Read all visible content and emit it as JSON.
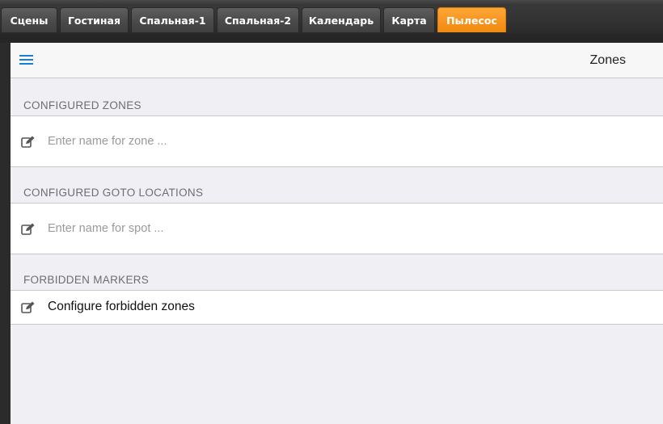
{
  "tabs": [
    {
      "label": "Сцены",
      "active": false
    },
    {
      "label": "Гостиная",
      "active": false
    },
    {
      "label": "Спальная-1",
      "active": false
    },
    {
      "label": "Спальная-2",
      "active": false
    },
    {
      "label": "Календарь",
      "active": false
    },
    {
      "label": "Карта",
      "active": false
    },
    {
      "label": "Пылесос",
      "active": true
    }
  ],
  "colors": {
    "active_tab": "#f7931e",
    "accent": "#1a7fd4"
  },
  "header": {
    "menu_icon": "hamburger-menu-icon",
    "title": "Zones"
  },
  "sections": {
    "zones": {
      "title": "CONFIGURED ZONES",
      "icon": "edit-icon",
      "placeholder": "Enter name for zone ..."
    },
    "goto": {
      "title": "CONFIGURED GOTO LOCATIONS",
      "icon": "edit-icon",
      "placeholder": "Enter name for spot ..."
    },
    "forbidden": {
      "title": "FORBIDDEN MARKERS",
      "icon": "edit-icon",
      "item_label": "Configure forbidden zones"
    }
  }
}
